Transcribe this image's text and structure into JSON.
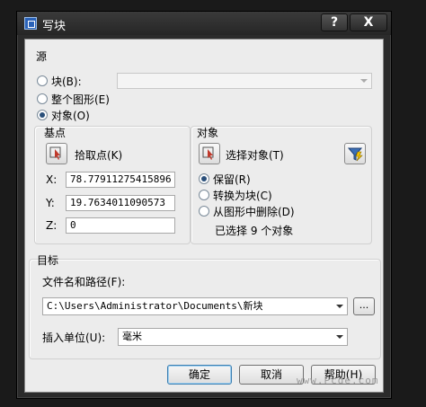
{
  "window": {
    "title": "写块",
    "help_label": "?",
    "close_label": "X"
  },
  "source": {
    "heading": "源",
    "options": [
      {
        "label": "块(B):",
        "selected": false
      },
      {
        "label": "整个图形(E)",
        "selected": false
      },
      {
        "label": "对象(O)",
        "selected": true
      }
    ],
    "block_combo_value": ""
  },
  "base_point": {
    "heading": "基点",
    "pick_label": "拾取点(K)",
    "x_label": "X:",
    "y_label": "Y:",
    "z_label": "Z:",
    "x_value": "78.77911275415896",
    "y_value": "19.7634011090573",
    "z_value": "0"
  },
  "objects": {
    "heading": "对象",
    "select_label": "选择对象(T)",
    "options": [
      {
        "label": "保留(R)",
        "selected": true
      },
      {
        "label": "转换为块(C)",
        "selected": false
      },
      {
        "label": "从图形中删除(D)",
        "selected": false
      }
    ],
    "status": "已选择 9 个对象"
  },
  "destination": {
    "heading": "目标",
    "path_label": "文件名和路径(F):",
    "path_value": "C:\\Users\\Administrator\\Documents\\新块",
    "browse_label": "...",
    "units_label": "插入单位(U):",
    "units_value": "毫米"
  },
  "buttons": {
    "ok": "确定",
    "cancel": "取消",
    "help": "帮助(H)"
  },
  "watermark": "www.Pcde.com",
  "colors": {
    "accent": "#3c7fb1",
    "title_bar": "#2b2b2b"
  }
}
